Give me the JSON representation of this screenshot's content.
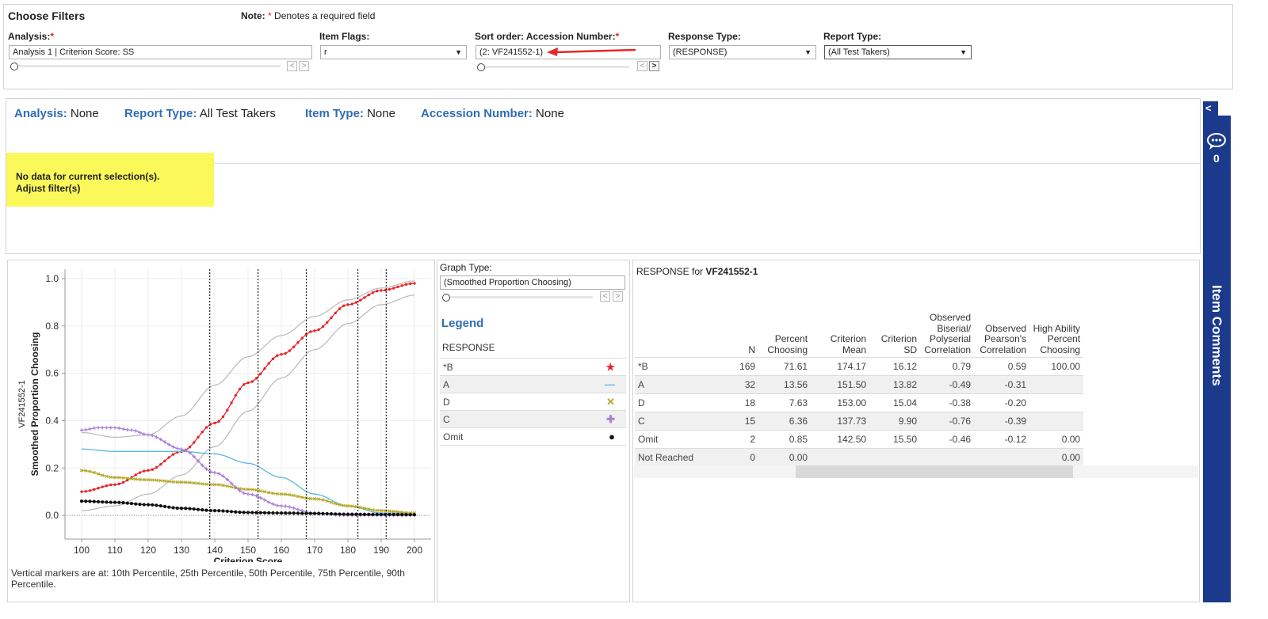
{
  "filters": {
    "title": "Choose Filters",
    "note_prefix": "Note:",
    "note_star": "*",
    "note_text": " Denotes a required field",
    "analysis": {
      "label": "Analysis:",
      "value": "Analysis 1 | Criterion Score: SS"
    },
    "item_flags": {
      "label": "Item Flags:",
      "value": "r"
    },
    "sort_order": {
      "label": "Sort order:  Accession Number:",
      "value": "(2: VF241552-1)"
    },
    "response_type": {
      "label": "Response Type:",
      "value": "(RESPONSE)"
    },
    "report_type": {
      "label": "Report Type:",
      "value": "(All Test Takers)"
    },
    "required_star": "*"
  },
  "summary": {
    "analysis_key": "Analysis:",
    "analysis_val": "None",
    "report_key": "Report Type:",
    "report_val": "All Test Takers",
    "item_type_key": "Item Type:",
    "item_type_val": "None",
    "accession_key": "Accession Number:",
    "accession_val": "None",
    "nodata_line1": "No data for current selection(s).",
    "nodata_line2": "Adjust filter(s)"
  },
  "chart_data": {
    "type": "line",
    "xlabel": "Criterion Score",
    "ylabel": "Smoothed Proportion Choosing",
    "ylabel2": "VF241552-1",
    "xticks": [
      100,
      110,
      120,
      130,
      140,
      150,
      160,
      170,
      180,
      190,
      200
    ],
    "yticks": [
      "0.0",
      "0.2",
      "0.4",
      "0.6",
      "0.8",
      "1.0"
    ],
    "xlim": [
      95,
      205
    ],
    "ylim": [
      -0.1,
      1.04
    ],
    "vlines": [
      138.5,
      153,
      167.5,
      183,
      191.5
    ],
    "series": [
      {
        "name": "*B",
        "color": "#e8262b",
        "marker": "star",
        "x": [
          100,
          110,
          120,
          130,
          140,
          150,
          160,
          170,
          180,
          190,
          200
        ],
        "y": [
          0.1,
          0.13,
          0.19,
          0.27,
          0.39,
          0.56,
          0.68,
          0.78,
          0.89,
          0.95,
          0.98
        ]
      },
      {
        "name": "A",
        "color": "#5bb8e0",
        "marker": "dash",
        "x": [
          100,
          110,
          120,
          130,
          140,
          150,
          160,
          170,
          180,
          190,
          200
        ],
        "y": [
          0.28,
          0.27,
          0.27,
          0.27,
          0.26,
          0.22,
          0.16,
          0.09,
          0.04,
          0.01,
          0.01
        ]
      },
      {
        "name": "D",
        "color": "#b5a827",
        "marker": "x",
        "x": [
          100,
          110,
          120,
          130,
          140,
          150,
          160,
          170,
          180,
          190,
          200
        ],
        "y": [
          0.19,
          0.16,
          0.15,
          0.14,
          0.13,
          0.11,
          0.09,
          0.07,
          0.04,
          0.02,
          0.01
        ]
      },
      {
        "name": "C",
        "color": "#a87ed8",
        "marker": "plus",
        "x": [
          100,
          105,
          110,
          115,
          120,
          130,
          140,
          150,
          160,
          170,
          180,
          190,
          200
        ],
        "y": [
          0.36,
          0.37,
          0.37,
          0.36,
          0.34,
          0.28,
          0.18,
          0.09,
          0.04,
          0.01,
          0.0,
          0.0,
          0.0
        ]
      },
      {
        "name": "Omit",
        "color": "#111111",
        "marker": "dot",
        "x": [
          100,
          110,
          120,
          130,
          140,
          150,
          160,
          170,
          180,
          190,
          200
        ],
        "y": [
          0.06,
          0.055,
          0.045,
          0.03,
          0.02,
          0.012,
          0.01,
          0.008,
          0.005,
          0.004,
          0.003
        ]
      }
    ],
    "bands": [
      {
        "x": [
          100,
          110,
          120,
          130,
          140,
          150,
          160,
          170,
          180,
          190,
          200
        ],
        "y": [
          0.35,
          0.33,
          0.34,
          0.42,
          0.55,
          0.67,
          0.76,
          0.84,
          0.91,
          0.96,
          0.99
        ]
      },
      {
        "x": [
          100,
          110,
          120,
          130,
          140,
          150,
          160,
          170,
          180,
          190,
          200
        ],
        "y": [
          0.02,
          0.04,
          0.09,
          0.17,
          0.29,
          0.44,
          0.58,
          0.7,
          0.81,
          0.89,
          0.93
        ]
      }
    ],
    "footnote": "Vertical markers are at: 10th Percentile, 25th Percentile, 50th Percentile, 75th Percentile, 90th Percentile."
  },
  "graph_panel": {
    "graph_type_label": "Graph Type:",
    "graph_type_value": "(Smoothed Proportion Choosing)",
    "legend_title": "Legend",
    "legend_group": "RESPONSE",
    "legend": [
      {
        "label": "*B",
        "symbol": "★",
        "color": "#e8262b"
      },
      {
        "label": "A",
        "symbol": "—",
        "color": "#5bb8e0"
      },
      {
        "label": "D",
        "symbol": "✕",
        "color": "#b5a827"
      },
      {
        "label": "C",
        "symbol": "✚",
        "color": "#a87ed8"
      },
      {
        "label": "Omit",
        "symbol": "●",
        "color": "#111111"
      }
    ]
  },
  "table": {
    "title_prefix": "RESPONSE",
    "title_mid": " for ",
    "title_item": "VF241552-1",
    "headers": [
      "",
      "N",
      "Percent Choosing",
      "Criterion Mean",
      "Criterion SD",
      "Observed Biserial/ Polyserial Correlation",
      "Observed Pearson's Correlation",
      "High Ability Percent Choosing"
    ],
    "rows": [
      [
        "*B",
        "169",
        "71.61",
        "174.17",
        "16.12",
        "0.79",
        "0.59",
        "100.00"
      ],
      [
        "A",
        "32",
        "13.56",
        "151.50",
        "13.82",
        "-0.49",
        "-0.31",
        ""
      ],
      [
        "D",
        "18",
        "7.63",
        "153.00",
        "15.04",
        "-0.38",
        "-0.20",
        ""
      ],
      [
        "C",
        "15",
        "6.36",
        "137.73",
        "9.90",
        "-0.76",
        "-0.39",
        ""
      ],
      [
        "Omit",
        "2",
        "0.85",
        "142.50",
        "15.50",
        "-0.46",
        "-0.12",
        "0.00"
      ],
      [
        "Not Reached",
        "0",
        "0.00",
        "",
        "",
        "",
        "",
        "0.00"
      ]
    ]
  },
  "comments": {
    "title": "Item Comments",
    "count": "0",
    "collapse": "<"
  }
}
